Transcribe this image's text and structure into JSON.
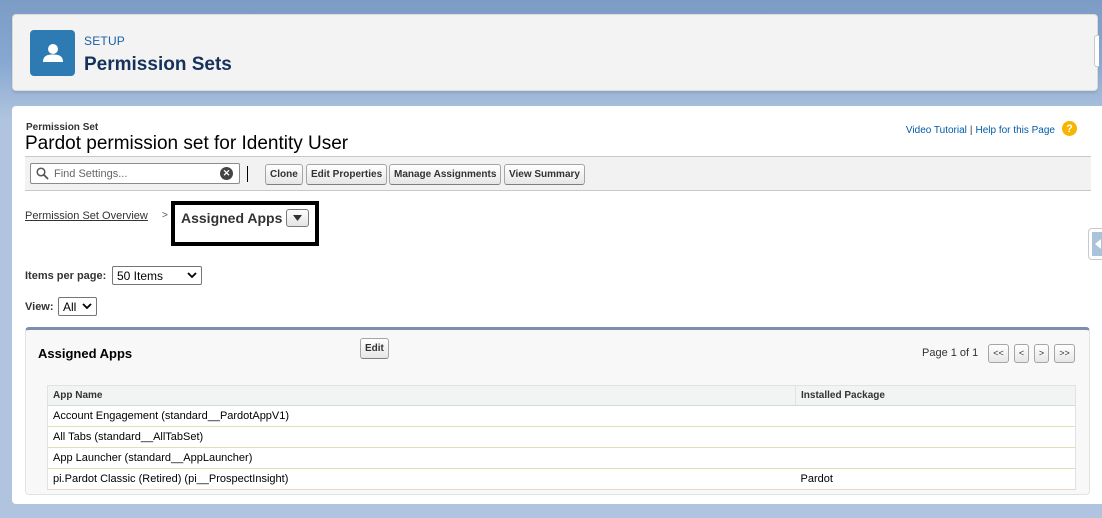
{
  "header": {
    "setup_label": "SETUP",
    "title": "Permission Sets"
  },
  "page": {
    "object_label": "Permission Set",
    "title": "Pardot permission set for Identity User",
    "video_tutorial": "Video Tutorial",
    "help_sep": "|",
    "help_link": "Help for this Page",
    "help_icon": "?"
  },
  "toolbar": {
    "search_placeholder": "Find Settings...",
    "clone": "Clone",
    "edit_properties": "Edit Properties",
    "manage_assignments": "Manage Assignments",
    "view_summary": "View Summary"
  },
  "breadcrumb": {
    "overview": "Permission Set Overview",
    "separator": ">",
    "current": "Assigned Apps"
  },
  "filters": {
    "items_per_page_label": "Items per page:",
    "items_per_page_value": "50 Items",
    "view_label": "View:",
    "view_value": "All"
  },
  "related_list": {
    "title": "Assigned Apps",
    "edit": "Edit",
    "page_info": "Page 1 of 1",
    "pager": {
      "first": "<<",
      "prev": "<",
      "next": ">",
      "last": ">>"
    },
    "columns": [
      "App Name",
      "Installed Package"
    ],
    "rows": [
      [
        "Account Engagement (standard__PardotAppV1)",
        ""
      ],
      [
        "All Tabs (standard__AllTabSet)",
        ""
      ],
      [
        "App Launcher (standard__AppLauncher)",
        ""
      ],
      [
        "pi.Pardot Classic (Retired) (pi__ProspectInsight)",
        "Pardot"
      ]
    ]
  },
  "colors": {
    "header_icon": "#2e7bb3",
    "link": "#015ba7",
    "help_icon": "#f7b500",
    "related_list_accent": "#7d8fb0"
  }
}
